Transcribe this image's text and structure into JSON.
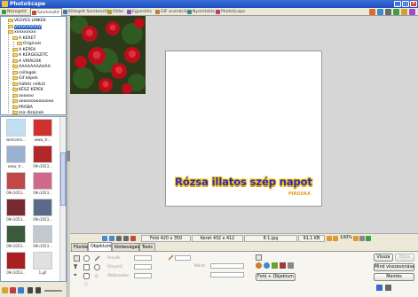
{
  "window": {
    "title": "PhotoScape"
  },
  "tabs": [
    {
      "label": "Nézegető",
      "color": "#3a9a3a"
    },
    {
      "label": "Szerkesztő",
      "color": "#c04a3a",
      "active": true
    },
    {
      "label": "Kötegelt Szerkesztő",
      "color": "#3a7ac0"
    },
    {
      "label": "Oldal",
      "color": "#b0a030"
    },
    {
      "label": "Egyesítés",
      "color": "#8a4ac0"
    },
    {
      "label": "GIF animáció",
      "color": "#c07a3a"
    },
    {
      "label": "Nyomtatás",
      "color": "#3a8a8a"
    },
    {
      "label": "PhotoScape",
      "color": "#c03a7a"
    }
  ],
  "tree": {
    "items": [
      {
        "label": "VEGYES LINKEK",
        "indent": 1,
        "selected": false
      },
      {
        "label": "VIVIVIVIVIVIVI",
        "indent": 1,
        "selected": true
      },
      {
        "label": "xxxxxxxxx",
        "indent": 1,
        "selected": false
      },
      {
        "label": "A KERET",
        "indent": 2,
        "selected": false
      },
      {
        "label": "Originals",
        "indent": 3,
        "selected": false
      },
      {
        "label": "A KÉPEK",
        "indent": 2,
        "selected": false
      },
      {
        "label": "A KERGESZITC",
        "indent": 2,
        "selected": false
      },
      {
        "label": "A VIRÁGOK",
        "indent": 2,
        "selected": false
      },
      {
        "label": "AAAAAAAAAAA",
        "indent": 2,
        "selected": false
      },
      {
        "label": "csillagok",
        "indent": 2,
        "selected": false
      },
      {
        "label": "Gif képek",
        "indent": 2,
        "selected": false
      },
      {
        "label": "Háttér nélkül",
        "indent": 2,
        "selected": false
      },
      {
        "label": "KÉSZ KÉPEK",
        "indent": 2,
        "selected": false
      },
      {
        "label": "oooooo",
        "indent": 2,
        "selected": false
      },
      {
        "label": "oooooooooooooo",
        "indent": 2,
        "selected": false
      },
      {
        "label": "PRÓBA",
        "indent": 2,
        "selected": false
      },
      {
        "label": "zsa dizajnok",
        "indent": 2,
        "selected": false
      }
    ]
  },
  "thumbnails": [
    {
      "label": "welcome...",
      "color": "#c0dff0"
    },
    {
      "label": "www_tr...",
      "color": "#d03030"
    },
    {
      "label": "www_tr...",
      "color": "#9ab0d0"
    },
    {
      "label": "09n1053...",
      "color": "#b02828"
    },
    {
      "label": "09n1053...",
      "color": "#c04848"
    },
    {
      "label": "09n1053...",
      "color": "#d06a8a"
    },
    {
      "label": "09n1053...",
      "color": "#7a2a30"
    },
    {
      "label": "09n1053...",
      "color": "#5a6a8a"
    },
    {
      "label": "09n1053...",
      "color": "#3a5a3a"
    },
    {
      "label": "09n1053...",
      "color": "#c0c8d0"
    },
    {
      "label": "09n1053...",
      "color": "#aa2020"
    },
    {
      "label": "1.gif",
      "color": "#e0e0e0"
    }
  ],
  "image": {
    "banner_text": "Rózsa illatos szép napot",
    "signature": "PIROSKA"
  },
  "status": {
    "photo_size": "Fotó 420 x 350",
    "frame_size": "Keret 432 x 412",
    "filename": "8 1.jpg",
    "filesize": "91.1 KB",
    "zoom": "100%"
  },
  "subtabs": [
    {
      "label": "Főoldal",
      "active": false
    },
    {
      "label": "Objektum",
      "active": true
    },
    {
      "label": "Körbevágás",
      "active": false
    },
    {
      "label": "Tools",
      "active": false
    }
  ],
  "panel": {
    "labels": {
      "shadow": "Árnyék",
      "brightness": "Fényerő",
      "opacity": "Átlátszatlan",
      "size": "Méret",
      "photo_object": "Fotó + Objektum"
    },
    "buttons": {
      "undo": "Vissza",
      "redo": "Előre",
      "undo_all": "Mind visszavonása",
      "save": "Mentés"
    }
  }
}
